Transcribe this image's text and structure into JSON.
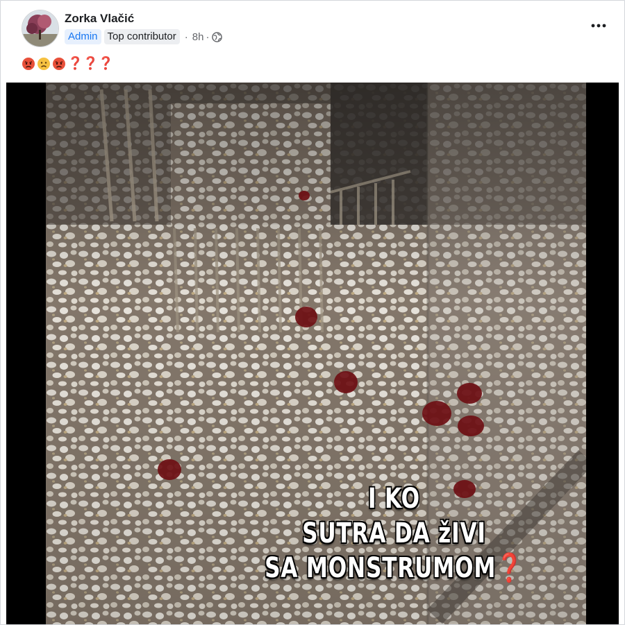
{
  "post": {
    "author": "Zorka Vlačić",
    "badges": {
      "admin": "Admin",
      "top_contributor": "Top contributor"
    },
    "time": "8h",
    "separator": "·",
    "audience_icon": "globe-icon",
    "more_icon": "more-horizontal-icon",
    "caption": {
      "emojis": [
        "angry-face-emoji",
        "frowning-face-emoji",
        "angry-face-emoji"
      ],
      "question_marks": [
        "❓",
        "❓",
        "❓"
      ]
    }
  },
  "video": {
    "overlay_lines": [
      "I KO",
      "SUTRA DA žIVI",
      "SA MONSTRUMOM"
    ],
    "overlay_trailing": "❓"
  },
  "colors": {
    "accent": "#1877f2",
    "text": "#1c1e21",
    "muted": "#65676b"
  }
}
